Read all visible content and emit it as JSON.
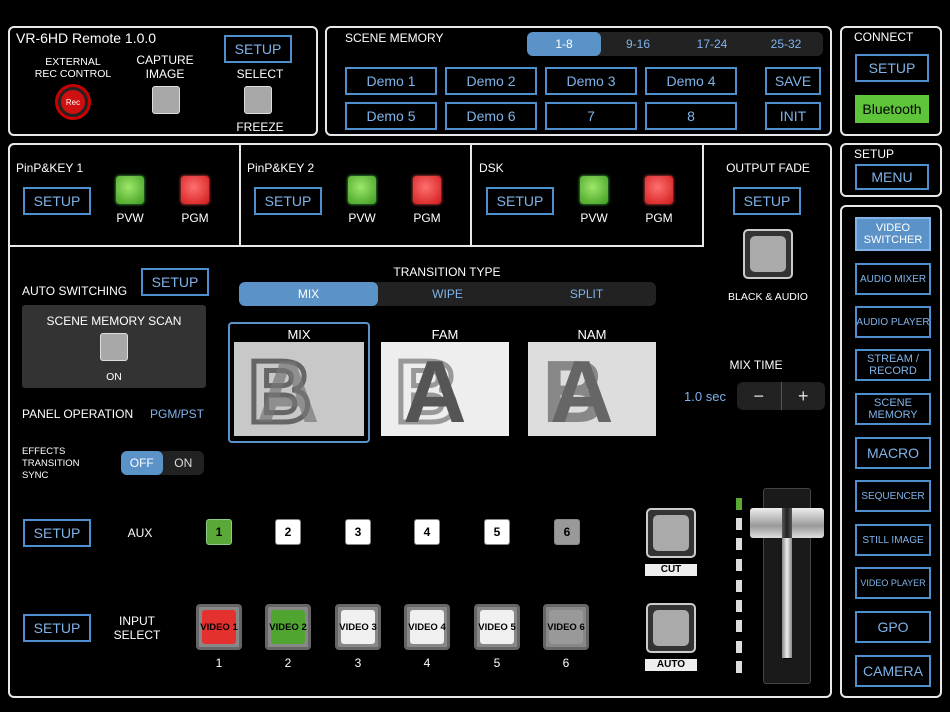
{
  "app": {
    "title": "VR-6HD Remote 1.0.0"
  },
  "top": {
    "external_rec_line1": "EXTERNAL",
    "external_rec_line2": "REC CONTROL",
    "rec_label": "Rec",
    "capture_line1": "CAPTURE",
    "capture_line2": "IMAGE",
    "setup": "SETUP",
    "select": "SELECT",
    "freeze": "FREEZE"
  },
  "scene_memory": {
    "title": "SCENE MEMORY",
    "tabs": [
      "1-8",
      "9-16",
      "17-24",
      "25-32"
    ],
    "slots": [
      "Demo 1",
      "Demo 2",
      "Demo 3",
      "Demo 4",
      "Demo 5",
      "Demo 6",
      "7",
      "8"
    ],
    "save": "SAVE",
    "init": "INIT"
  },
  "connect": {
    "title": "CONNECT",
    "setup": "SETUP",
    "bluetooth": "Bluetooth"
  },
  "setup_menu": {
    "title": "SETUP",
    "menu": "MENU"
  },
  "nav": {
    "items": [
      "VIDEO SWITCHER",
      "AUDIO MIXER",
      "AUDIO PLAYER",
      "STREAM / RECORD",
      "SCENE MEMORY",
      "MACRO",
      "SEQUENCER",
      "STILL IMAGE",
      "VIDEO PLAYER",
      "GPO",
      "CAMERA"
    ]
  },
  "keys": [
    {
      "title": "PinP&KEY 1",
      "setup": "SETUP",
      "pvw": "PVW",
      "pgm": "PGM"
    },
    {
      "title": "PinP&KEY 2",
      "setup": "SETUP",
      "pvw": "PVW",
      "pgm": "PGM"
    },
    {
      "title": "DSK",
      "setup": "SETUP",
      "pvw": "PVW",
      "pgm": "PGM"
    }
  ],
  "output_fade": {
    "title": "OUTPUT FADE",
    "setup": "SETUP",
    "black_audio": "BLACK & AUDIO"
  },
  "auto_switching": {
    "title": "AUTO SWITCHING",
    "setup": "SETUP",
    "scan_title": "SCENE MEMORY SCAN",
    "scan_state": "ON"
  },
  "panel_operation": {
    "label": "PANEL OPERATION",
    "value": "PGM/PST"
  },
  "effects_sync": {
    "line1": "EFFECTS",
    "line2": "TRANSITION",
    "line3": "SYNC",
    "off": "OFF",
    "on": "ON"
  },
  "transition": {
    "title": "TRANSITION TYPE",
    "types": [
      "MIX",
      "WIPE",
      "SPLIT"
    ],
    "previews": [
      "MIX",
      "FAM",
      "NAM"
    ]
  },
  "mix_time": {
    "title": "MIX TIME",
    "value": "1.0 sec",
    "minus": "−",
    "plus": "+"
  },
  "aux": {
    "setup": "SETUP",
    "label": "AUX",
    "buttons": [
      "1",
      "2",
      "3",
      "4",
      "5",
      "6"
    ]
  },
  "input": {
    "setup": "SETUP",
    "label_line1": "INPUT",
    "label_line2": "SELECT",
    "buttons": [
      "VIDEO 1",
      "VIDEO 2",
      "VIDEO 3",
      "VIDEO 4",
      "VIDEO 5",
      "VIDEO 6"
    ],
    "numbers": [
      "1",
      "2",
      "3",
      "4",
      "5",
      "6"
    ]
  },
  "actions": {
    "cut": "CUT",
    "auto": "AUTO"
  },
  "fader": {
    "position": 0.0
  },
  "colors": {
    "accent": "#5b93c9",
    "pgm": "#d01818",
    "pvw": "#3d9a1f",
    "bluetooth": "#5ec43a"
  }
}
